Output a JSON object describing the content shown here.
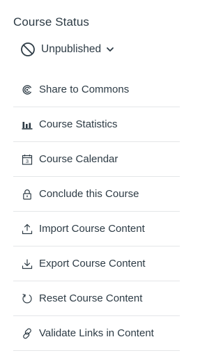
{
  "status": {
    "heading": "Course Status",
    "publish_toggle": {
      "label": "Unpublished",
      "icon": "unpublished-circle-slash-icon",
      "dropdown_icon": "chevron-down-icon"
    }
  },
  "menu": {
    "items": [
      {
        "label": "Share to Commons",
        "icon": "commons-icon"
      },
      {
        "label": "Course Statistics",
        "icon": "bar-chart-icon"
      },
      {
        "label": "Course Calendar",
        "icon": "calendar-icon"
      },
      {
        "label": "Conclude this Course",
        "icon": "lock-icon"
      },
      {
        "label": "Import Course Content",
        "icon": "upload-icon"
      },
      {
        "label": "Export Course Content",
        "icon": "download-icon"
      },
      {
        "label": "Reset Course Content",
        "icon": "reset-icon"
      },
      {
        "label": "Validate Links in Content",
        "icon": "link-icon"
      }
    ],
    "calendar_day": "3"
  },
  "colors": {
    "text": "#2d3b45",
    "divider": "#e4e6e8"
  }
}
